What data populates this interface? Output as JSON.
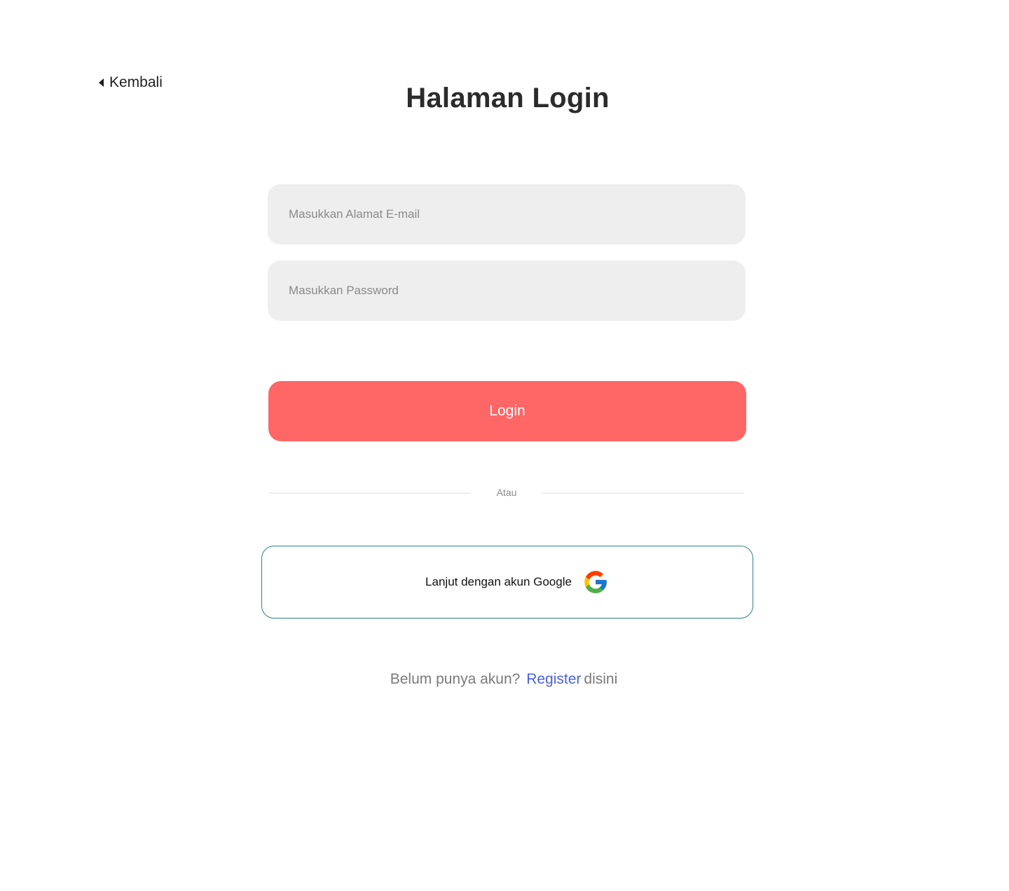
{
  "nav": {
    "back_label": "Kembali"
  },
  "page": {
    "title": "Halaman Login"
  },
  "form": {
    "email_placeholder": "Masukkan Alamat E-mail",
    "email_value": "",
    "password_placeholder": "Masukkan Password",
    "password_value": "",
    "login_label": "Login",
    "divider_label": "Atau",
    "google_label": "Lanjut dengan akun Google",
    "google_icon": "google-icon"
  },
  "footer": {
    "prompt": "Belum punya akun?",
    "register_link": "Register",
    "suffix": "disini"
  },
  "colors": {
    "accent": "#ff6666",
    "field_bg": "#eeeeee",
    "google_border": "#2a8585",
    "link": "#4a62d8"
  }
}
